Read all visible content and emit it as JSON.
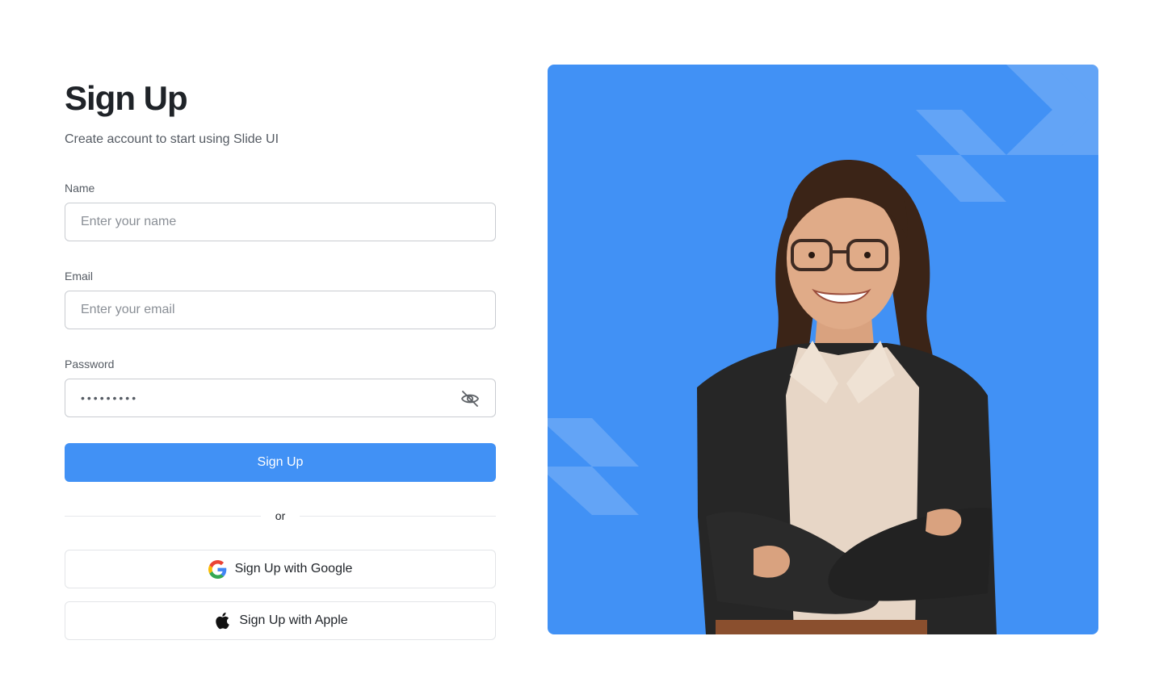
{
  "form": {
    "title": "Sign Up",
    "subtitle": "Create account to start using Slide UI",
    "name_label": "Name",
    "name_placeholder": "Enter your name",
    "email_label": "Email",
    "email_placeholder": "Enter your email",
    "password_label": "Password",
    "password_value": "•••••••••",
    "password_toggle_icon": "eye-off-icon",
    "submit_label": "Sign Up",
    "divider_text": "or",
    "google_label": "Sign Up with Google",
    "google_icon": "google-icon",
    "apple_label": "Sign Up with Apple",
    "apple_icon": "apple-icon"
  },
  "hero": {
    "background_color": "#4191f5",
    "image": "smiling woman with glasses and crossed arms"
  },
  "colors": {
    "primary": "#4191f5",
    "text": "#1f2328",
    "muted": "#555b63",
    "border": "#c9ccd1"
  }
}
